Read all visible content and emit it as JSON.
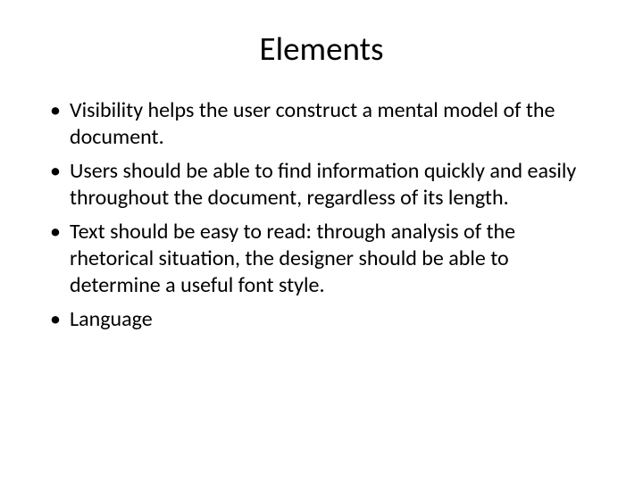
{
  "slide": {
    "title": "Elements",
    "bullets": [
      "Visibility helps the user construct a mental model of the document.",
      "Users should be able to find information quickly and easily throughout the document, regardless of its length.",
      "Text should be easy to read: through analysis of the rhetorical situation, the designer should be able to determine a useful font style.",
      "Language"
    ]
  }
}
